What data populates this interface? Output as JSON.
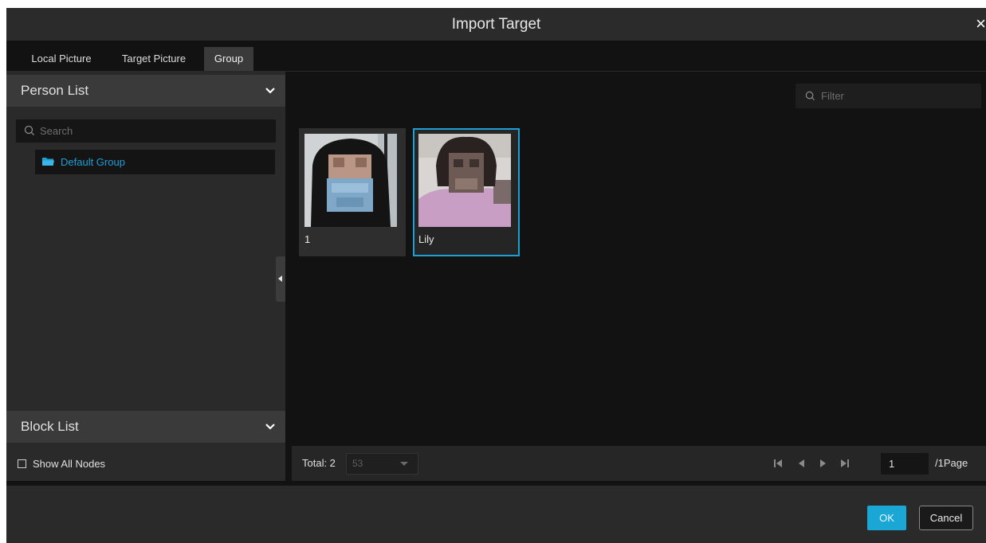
{
  "dialog": {
    "title": "Import Target",
    "close_symbol": "×"
  },
  "tabs": [
    {
      "label": "Local Picture",
      "active": false
    },
    {
      "label": "Target Picture",
      "active": false
    },
    {
      "label": "Group",
      "active": true
    }
  ],
  "sidebar": {
    "person_list_label": "Person List",
    "search_placeholder": "Search",
    "groups": [
      {
        "label": "Default Group",
        "icon": "folder-icon"
      }
    ],
    "block_list_label": "Block List",
    "show_all_nodes_label": "Show All Nodes",
    "show_all_nodes_checked": false
  },
  "main": {
    "filter_placeholder": "Filter",
    "targets": [
      {
        "name": "1",
        "selected": false
      },
      {
        "name": "Lily",
        "selected": true
      }
    ]
  },
  "pagination": {
    "total_label": "Total: 2",
    "page_size": "53",
    "current_page": "1",
    "total_pages_label": "/1Page"
  },
  "actions": {
    "ok_label": "OK",
    "cancel_label": "Cancel"
  },
  "colors": {
    "accent": "#1ba7d6",
    "background": "#121212",
    "panel": "#2a2a2a"
  }
}
